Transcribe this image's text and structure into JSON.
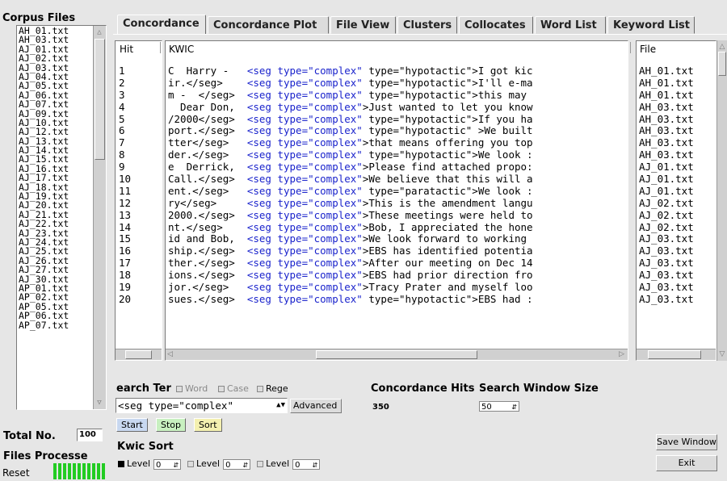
{
  "corpus": {
    "title": "Corpus Files",
    "files": [
      "AH_01.txt",
      "AH_03.txt",
      "AJ_01.txt",
      "AJ_02.txt",
      "AJ_03.txt",
      "AJ_04.txt",
      "AJ_05.txt",
      "AJ_06.txt",
      "AJ_07.txt",
      "AJ_09.txt",
      "AJ_10.txt",
      "AJ_12.txt",
      "AJ_13.txt",
      "AJ_14.txt",
      "AJ_15.txt",
      "AJ_16.txt",
      "AJ_17.txt",
      "AJ_18.txt",
      "AJ_19.txt",
      "AJ_20.txt",
      "AJ_21.txt",
      "AJ_22.txt",
      "AJ_23.txt",
      "AJ_24.txt",
      "AJ_25.txt",
      "AJ_26.txt",
      "AJ_27.txt",
      "AJ_30.txt",
      "AP_01.txt",
      "AP_02.txt",
      "AP_05.txt",
      "AP_06.txt",
      "AP_07.txt"
    ],
    "total_label": "Total No.",
    "total_value": "100",
    "processed_label": "Files Processe",
    "reset_label": "Reset"
  },
  "tabs": [
    {
      "label": "Concordance",
      "active": true
    },
    {
      "label": "Concordance Plot",
      "active": false
    },
    {
      "label": "File View",
      "active": false
    },
    {
      "label": "Clusters",
      "active": false
    },
    {
      "label": "Collocates",
      "active": false
    },
    {
      "label": "Word List",
      "active": false
    },
    {
      "label": "Keyword List",
      "active": false
    }
  ],
  "results": {
    "hit_header": "Hit",
    "kwic_header": "KWIC",
    "file_header": "File",
    "rows": [
      {
        "hit": "1",
        "left": "C  Harry -  ",
        "kwic": "<seg type=\"complex\"",
        "right": " type=\"hypotactic\">I got kic",
        "file": "AH_01.txt"
      },
      {
        "hit": "2",
        "left": "ir.</seg>   ",
        "kwic": "<seg type=\"complex\"",
        "right": " type=\"hypotactic\">I'll e-ma",
        "file": "AH_01.txt"
      },
      {
        "hit": "3",
        "left": "m -  </seg> ",
        "kwic": "<seg type=\"complex\"",
        "right": " type=\"hypotactic\">this may",
        "file": "AH_01.txt"
      },
      {
        "hit": "4",
        "left": "  Dear Don, ",
        "kwic": "<seg type=\"complex\"",
        "right": ">Just wanted to let you know",
        "file": "AH_03.txt"
      },
      {
        "hit": "5",
        "left": "/2000</seg> ",
        "kwic": "<seg type=\"complex\"",
        "right": " type=\"hypotactic\">If you ha",
        "file": "AH_03.txt"
      },
      {
        "hit": "6",
        "left": "port.</seg> ",
        "kwic": "<seg type=\"complex\"",
        "right": " type=\"hypotactic\" >We built",
        "file": "AH_03.txt"
      },
      {
        "hit": "7",
        "left": "tter</seg>  ",
        "kwic": "<seg type=\"complex\"",
        "right": ">that means offering you top",
        "file": "AH_03.txt"
      },
      {
        "hit": "8",
        "left": "der.</seg>  ",
        "kwic": "<seg type=\"complex\"",
        "right": " type=\"hypotactic\">We look :",
        "file": "AH_03.txt"
      },
      {
        "hit": "9",
        "left": "e  Derrick, ",
        "kwic": "<seg type=\"complex\"",
        "right": ">Please find attached propo:",
        "file": "AJ_01.txt"
      },
      {
        "hit": "10",
        "left": "Call.</seg> ",
        "kwic": "<seg type=\"complex\"",
        "right": ">We believe that this will a",
        "file": "AJ_01.txt"
      },
      {
        "hit": "11",
        "left": "ent.</seg>  ",
        "kwic": "<seg type=\"complex\"",
        "right": " type=\"paratactic\">We look :",
        "file": "AJ_01.txt"
      },
      {
        "hit": "12",
        "left": "ry</seg>    ",
        "kwic": "<seg type=\"complex\"",
        "right": ">This is the amendment langu",
        "file": "AJ_02.txt"
      },
      {
        "hit": "13",
        "left": "2000.</seg> ",
        "kwic": "<seg type=\"complex\"",
        "right": ">These meetings were held to",
        "file": "AJ_02.txt"
      },
      {
        "hit": "14",
        "left": "nt.</seg>   ",
        "kwic": "<seg type=\"complex\"",
        "right": ">Bob, I appreciated the hone",
        "file": "AJ_02.txt"
      },
      {
        "hit": "15",
        "left": "id and Bob, ",
        "kwic": "<seg type=\"complex\"",
        "right": ">We look forward to working",
        "file": "AJ_03.txt"
      },
      {
        "hit": "16",
        "left": "ship.</seg> ",
        "kwic": "<seg type=\"complex\"",
        "right": ">EBS has identified potentia",
        "file": "AJ_03.txt"
      },
      {
        "hit": "17",
        "left": "ther.</seg> ",
        "kwic": "<seg type=\"complex\"",
        "right": ">After our meeting on Dec 14",
        "file": "AJ_03.txt"
      },
      {
        "hit": "18",
        "left": "ions.</seg> ",
        "kwic": "<seg type=\"complex\"",
        "right": ">EBS had prior direction fro",
        "file": "AJ_03.txt"
      },
      {
        "hit": "19",
        "left": "jor.</seg>  ",
        "kwic": "<seg type=\"complex\"",
        "right": ">Tracy Prater and myself loo",
        "file": "AJ_03.txt"
      },
      {
        "hit": "20",
        "left": "sues.</seg> ",
        "kwic": "<seg type=\"complex\"",
        "right": " type=\"hypotactic\">EBS had :",
        "file": "AJ_03.txt"
      }
    ]
  },
  "search": {
    "label": "earch Ter",
    "word_label": "Word",
    "case_label": "Case",
    "regex_label": "Rege",
    "query_value": "<seg type=\"complex\"",
    "advanced_label": "Advanced",
    "hits_label": "Concordance Hits",
    "hits_value": "350",
    "window_label": "Search Window Size",
    "window_value": "50",
    "start_label": "Start",
    "stop_label": "Stop",
    "sort_label": "Sort"
  },
  "kwic_sort": {
    "title": "Kwic Sort",
    "levels": [
      {
        "label": "Level",
        "value": "0",
        "checked": true
      },
      {
        "label": "Level",
        "value": "0",
        "checked": false
      },
      {
        "label": "Level",
        "value": "0",
        "checked": false
      }
    ]
  },
  "actions": {
    "save_label": "Save Window",
    "exit_label": "Exit"
  },
  "colors": {
    "kwic": "#1a23cc",
    "start": "#c8d8f0",
    "stop": "#c8f0c0",
    "sort": "#f4f0b0",
    "progress": "#22cc22"
  }
}
